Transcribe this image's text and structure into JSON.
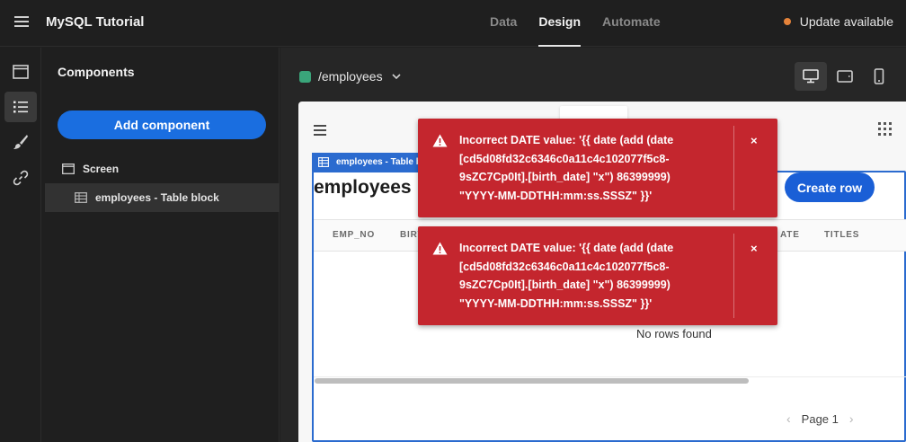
{
  "header": {
    "app_title": "MySQL Tutorial",
    "tabs": [
      {
        "label": "Data",
        "active": false
      },
      {
        "label": "Design",
        "active": true
      },
      {
        "label": "Automate",
        "active": false
      }
    ],
    "update_label": "Update available",
    "update_dot_color": "#e5833a"
  },
  "rail": {
    "items": [
      "screen-icon",
      "list-icon",
      "brush-icon",
      "link-icon"
    ],
    "active": "list-icon"
  },
  "panel": {
    "title": "Components",
    "add_button": "Add component",
    "tree": [
      {
        "label": "Screen",
        "icon": "screen-icon",
        "selected": false
      },
      {
        "label": "employees - Table block",
        "icon": "table-icon",
        "selected": true
      }
    ]
  },
  "canvas": {
    "route": "/employees",
    "route_color": "#3aa57a",
    "devices": [
      "desktop-icon",
      "tablet-icon",
      "mobile-icon"
    ],
    "active_device": "desktop-icon",
    "block_tag": "employees - Table b",
    "block_title": "employees",
    "create_button": "Create row",
    "columns": [
      "EMP_NO",
      "BIRT",
      "ATE",
      "TITLES"
    ],
    "empty_text": "No rows found",
    "page_label": "Page 1"
  },
  "toasts": [
    {
      "message_line1": "Incorrect DATE value: '{{ date (add (date",
      "message_line2": "[cd5d08fd32c6346c0a11c4c102077f5c8-",
      "message_line3": "9sZC7Cp0It].[birth_date] \"x\") 86399999)",
      "message_line4": "\"YYYY-MM-DDTHH:mm:ss.SSSZ\" }}'",
      "close": "×"
    },
    {
      "message_line1": "Incorrect DATE value: '{{ date (add (date",
      "message_line2": "[cd5d08fd32c6346c0a11c4c102077f5c8-",
      "message_line3": "9sZC7Cp0It].[birth_date] \"x\") 86399999)",
      "message_line4": "\"YYYY-MM-DDTHH:mm:ss.SSSZ\" }}'",
      "close": "×"
    }
  ],
  "colors": {
    "accent": "#1a6ee0",
    "toast": "#c4262e",
    "selection": "#2b6bcf"
  }
}
